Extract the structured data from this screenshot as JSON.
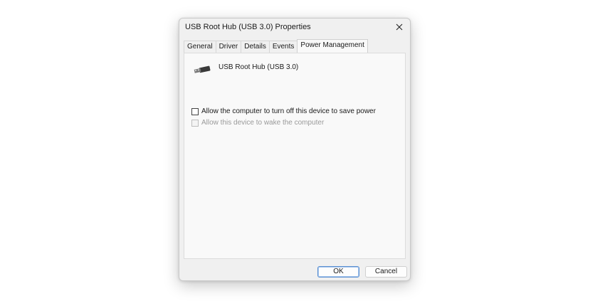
{
  "window": {
    "title": "USB Root Hub (USB 3.0) Properties",
    "close_icon": "close-icon"
  },
  "tabs": [
    {
      "label": "General"
    },
    {
      "label": "Driver"
    },
    {
      "label": "Details"
    },
    {
      "label": "Events"
    },
    {
      "label": "Power Management",
      "active": true
    }
  ],
  "device": {
    "icon": "usb-connector-icon",
    "name": "USB Root Hub (USB 3.0)"
  },
  "options": {
    "allow_turn_off": {
      "label": "Allow the computer to turn off this device to save power",
      "checked": false,
      "enabled": true
    },
    "allow_wake": {
      "label": "Allow this device to wake the computer",
      "checked": false,
      "enabled": false
    }
  },
  "buttons": {
    "ok_label": "OK",
    "cancel_label": "Cancel"
  }
}
